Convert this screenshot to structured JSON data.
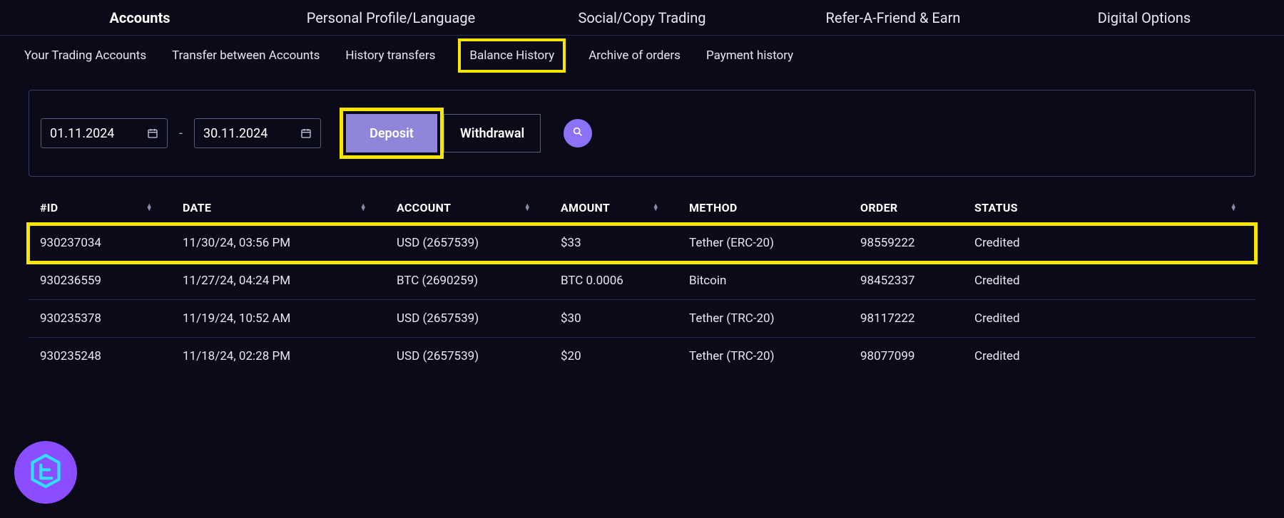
{
  "topnav": {
    "items": [
      {
        "label": "Accounts",
        "active": true
      },
      {
        "label": "Personal Profile/Language",
        "active": false
      },
      {
        "label": "Social/Copy Trading",
        "active": false
      },
      {
        "label": "Refer-A-Friend & Earn",
        "active": false
      },
      {
        "label": "Digital Options",
        "active": false
      }
    ]
  },
  "subnav": {
    "items": [
      {
        "label": "Your Trading Accounts",
        "highlighted": false
      },
      {
        "label": "Transfer between Accounts",
        "highlighted": false
      },
      {
        "label": "History transfers",
        "highlighted": false
      },
      {
        "label": "Balance History",
        "highlighted": true
      },
      {
        "label": "Archive of orders",
        "highlighted": false
      },
      {
        "label": "Payment history",
        "highlighted": false
      }
    ]
  },
  "filters": {
    "date_from": "01.11.2024",
    "date_to": "30.11.2024",
    "deposit_label": "Deposit",
    "withdrawal_label": "Withdrawal",
    "active_toggle": "deposit"
  },
  "table": {
    "headers": {
      "id": "#ID",
      "date": "DATE",
      "account": "ACCOUNT",
      "amount": "AMOUNT",
      "method": "METHOD",
      "order": "ORDER",
      "status": "STATUS"
    },
    "rows": [
      {
        "id": "930237034",
        "date": "11/30/24, 03:56 PM",
        "account": "USD (2657539)",
        "amount": "$33",
        "method": "Tether (ERC-20)",
        "order": "98559222",
        "status": "Credited",
        "highlight": true
      },
      {
        "id": "930236559",
        "date": "11/27/24, 04:24 PM",
        "account": "BTC (2690259)",
        "amount": "BTC 0.0006",
        "method": "Bitcoin",
        "order": "98452337",
        "status": "Credited",
        "highlight": false
      },
      {
        "id": "930235378",
        "date": "11/19/24, 10:52 AM",
        "account": "USD (2657539)",
        "amount": "$30",
        "method": "Tether (TRC-20)",
        "order": "98117222",
        "status": "Credited",
        "highlight": false
      },
      {
        "id": "930235248",
        "date": "11/18/24, 02:28 PM",
        "account": "USD (2657539)",
        "amount": "$20",
        "method": "Tether (TRC-20)",
        "order": "98077099",
        "status": "Credited",
        "highlight": false
      }
    ]
  }
}
